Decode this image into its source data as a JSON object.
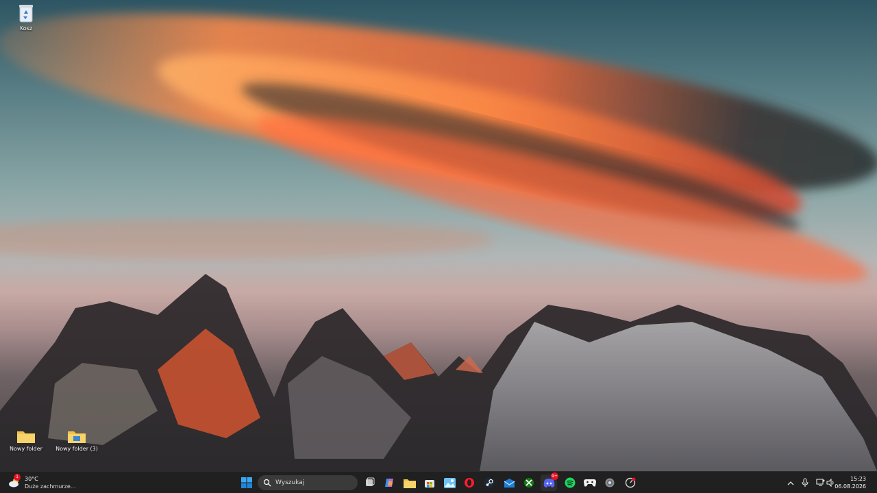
{
  "desktop": {
    "icons": [
      {
        "label": "Kosz",
        "icon": "recycle-bin-icon"
      },
      {
        "label": "Nowy folder",
        "icon": "folder-icon"
      },
      {
        "label": "Nowy folder (3)",
        "icon": "folder-icon"
      }
    ]
  },
  "taskbar": {
    "weather": {
      "temp": "30°C",
      "condition": "Duże zachmurze...",
      "badge": "1",
      "icon": "cloud-sun-icon"
    },
    "search": {
      "placeholder": "Wyszukaj",
      "icon": "search-icon"
    },
    "apps": [
      {
        "name": "start-button",
        "icon": "windows-logo-icon"
      },
      {
        "name": "task-view",
        "icon": "task-view-icon"
      },
      {
        "name": "copilot",
        "icon": "copilot-icon"
      },
      {
        "name": "file-explorer",
        "icon": "folder-icon"
      },
      {
        "name": "microsoft-store",
        "icon": "store-icon"
      },
      {
        "name": "photos",
        "icon": "photos-icon"
      },
      {
        "name": "opera",
        "icon": "opera-icon"
      },
      {
        "name": "steam",
        "icon": "steam-icon"
      },
      {
        "name": "mail",
        "icon": "mail-icon"
      },
      {
        "name": "xbox",
        "icon": "xbox-icon"
      },
      {
        "name": "discord",
        "icon": "discord-icon",
        "badge": "9+"
      },
      {
        "name": "spotify",
        "icon": "spotify-icon"
      },
      {
        "name": "epic",
        "icon": "game-controller-icon"
      },
      {
        "name": "settings",
        "icon": "gear-icon"
      },
      {
        "name": "app-extra",
        "icon": "chart-icon"
      }
    ],
    "tray": {
      "time": "15:23",
      "date": "06.08.2026"
    }
  },
  "colors": {
    "taskbar_bg": "#202020",
    "accent": "#0078d4"
  }
}
